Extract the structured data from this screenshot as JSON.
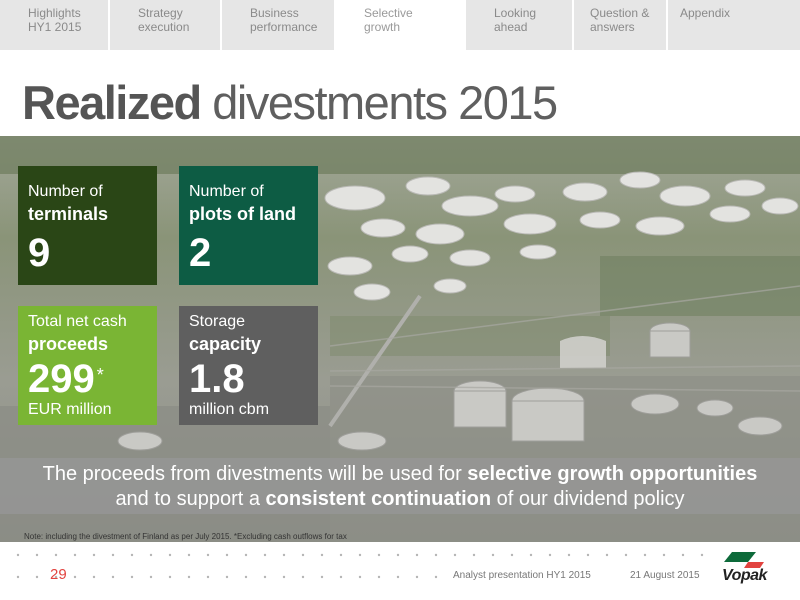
{
  "nav": {
    "tabs": [
      {
        "line1": "Highlights",
        "line2": "HY1 2015",
        "active": false
      },
      {
        "line1": "Strategy",
        "line2": "execution",
        "active": false
      },
      {
        "line1": "Business",
        "line2": "performance",
        "active": false
      },
      {
        "line1": "Selective",
        "line2": "growth",
        "active": true
      },
      {
        "line1": "Looking",
        "line2": "ahead",
        "active": false
      },
      {
        "line1": "Question &",
        "line2": "answers",
        "active": false
      },
      {
        "line1": "Appendix",
        "line2": "",
        "active": false
      }
    ]
  },
  "title": {
    "bold": "Realized",
    "rest": "divestments 2015"
  },
  "tiles": {
    "terminals": {
      "line1": "Number of",
      "line2": "terminals",
      "value": "9",
      "color": "#2a4616"
    },
    "plots": {
      "line1": "Number of",
      "line2": "plots of land",
      "value": "2",
      "color": "#0d5c44"
    },
    "proceeds": {
      "line1": "Total net cash",
      "line2": "proceeds",
      "value": "299",
      "star": "*",
      "unit": "EUR million",
      "color": "#7ab534"
    },
    "storage": {
      "line1": "Storage",
      "line2": "capacity",
      "value": "1.8",
      "unit": "million cbm",
      "color": "#5f5f5f"
    }
  },
  "band": {
    "line1_pre": "The proceeds from divestments will be used for ",
    "line1_bold": "selective growth opportunities",
    "line2_pre": "and to support a ",
    "line2_bold": "consistent continuation",
    "line2_post": " of our dividend policy"
  },
  "note": "Note: including the divestment of Finland as per July 2015. *Excluding cash outflows for tax",
  "footer": {
    "page": "29",
    "presentation": "Analyst presentation HY1 2015",
    "date": "21 August 2015",
    "logo_text": "Vopak"
  },
  "colors": {
    "accent_red": "#e2433f",
    "logo_green": "#0d6a3a"
  }
}
